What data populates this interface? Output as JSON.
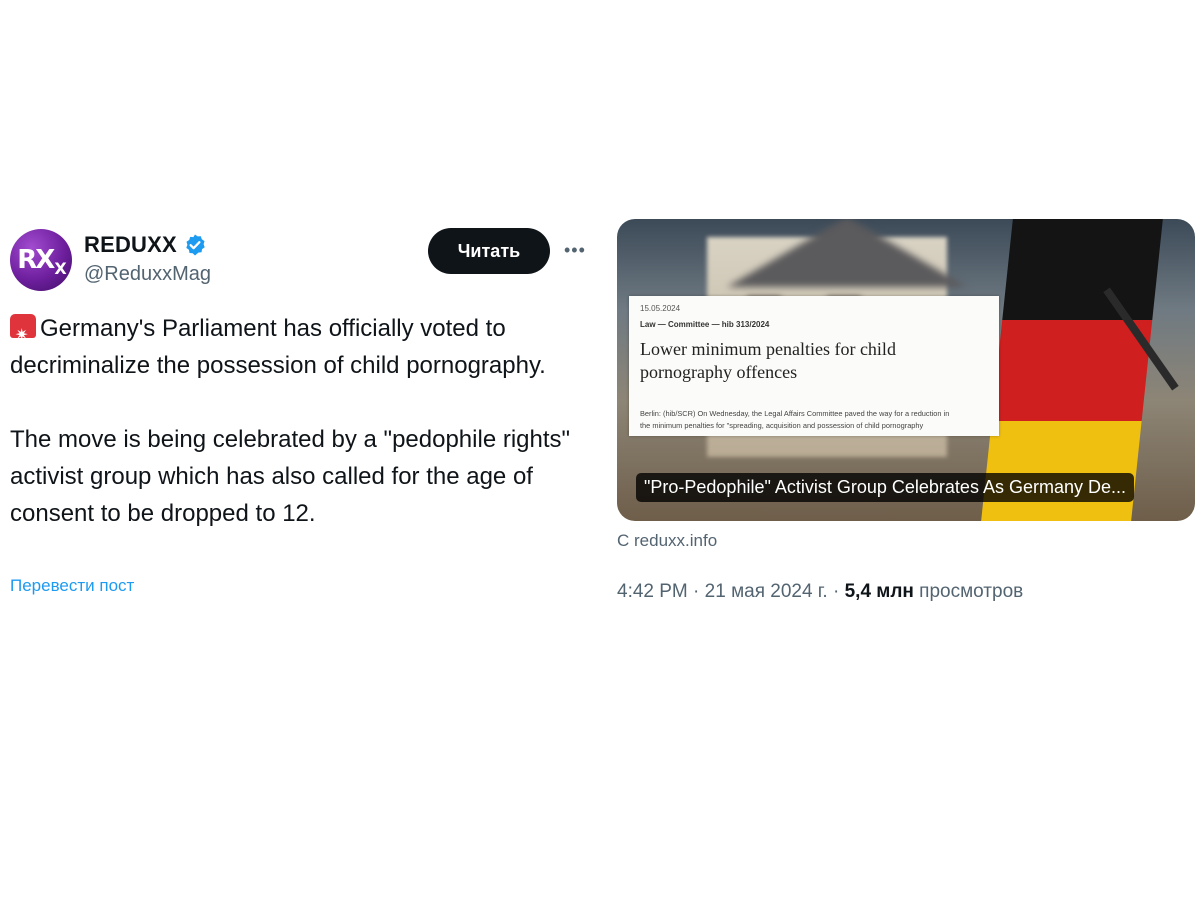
{
  "author": {
    "display_name": "REDUXX",
    "handle": "@ReduxxMag",
    "avatar_text": "RX",
    "avatar_sub": "X",
    "verified_icon": "verified-badge-icon"
  },
  "actions": {
    "follow_label": "Читать",
    "more_label": "•••"
  },
  "tweet": {
    "paragraph1": "Germany's Parliament has officially voted to decriminalize the possession of child pornography.",
    "paragraph2": "The move is being celebrated by a \"pedophile rights\" activist group which has also called for the age of consent to be dropped to 12.",
    "translate_label": "Перевести пост",
    "emoji_icon": "police-siren-icon"
  },
  "card": {
    "doc_date": "15.05.2024",
    "doc_category": "Law — Committee — hib 313/2024",
    "doc_headline": "Lower minimum penalties for child pornography offences",
    "doc_body_line1": "Berlin: (hib/SCR) On Wednesday, the Legal Affairs Committee paved the way for a reduction in",
    "doc_body_line2": "the minimum penalties for \"spreading, acquisition and possession of child pornography",
    "title": "\"Pro-Pedophile\" Activist Group Celebrates As Germany De...",
    "source": "С reduxx.info"
  },
  "meta": {
    "time": "4:42 PM",
    "separator": "·",
    "date": "21 мая 2024 г.",
    "views_count": "5,4 млн",
    "views_label": "просмотров"
  },
  "colors": {
    "accent": "#1d9bf0",
    "button_bg": "#0f1419",
    "muted_text": "#536471",
    "avatar_purple": "#6d1f9d",
    "flag_black": "#141414",
    "flag_red": "#cf1f1f",
    "flag_gold": "#f0c010"
  }
}
